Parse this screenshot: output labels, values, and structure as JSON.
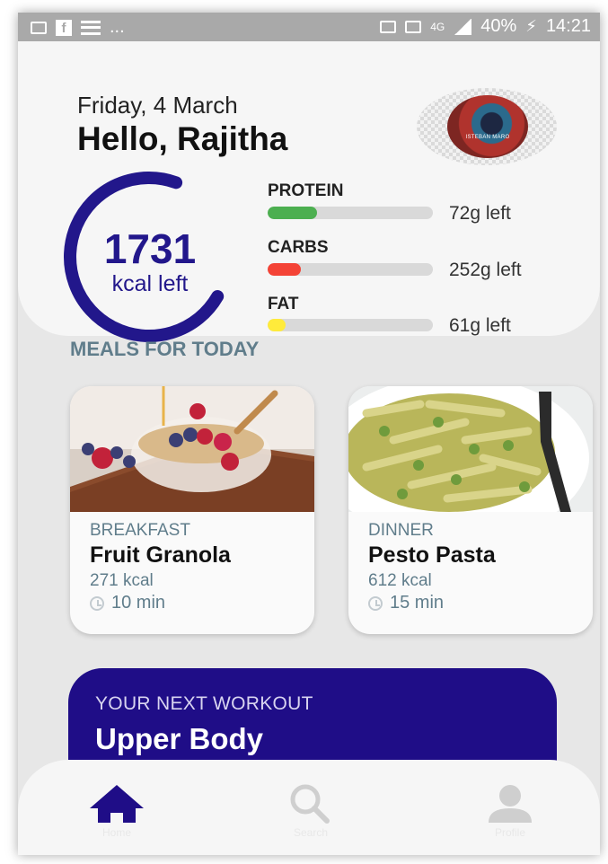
{
  "status_bar": {
    "left_icons": [
      "mail-icon",
      "facebook-icon",
      "menu-icon"
    ],
    "overflow": "...",
    "network": "4G",
    "battery": "40%",
    "time": "14:21"
  },
  "header": {
    "date": "Friday, 4 March",
    "greeting": "Hello, Rajitha",
    "avatar_caption": "ISTEBAN MARO"
  },
  "calories": {
    "value": "1731",
    "label": "kcal left",
    "ring_color": "#22178b"
  },
  "macros": [
    {
      "name": "PROTEIN",
      "left": "72g left",
      "fill_fraction": 0.3,
      "color": "#4caf50"
    },
    {
      "name": "CARBS",
      "left": "252g left",
      "fill_fraction": 0.2,
      "color": "#f44336"
    },
    {
      "name": "FAT",
      "left": "61g left",
      "fill_fraction": 0.11,
      "color": "#ffeb3b"
    }
  ],
  "meals_section": {
    "title": "MEALS FOR TODAY",
    "meals": [
      {
        "type": "BREAKFAST",
        "name": "Fruit Granola",
        "kcal": "271 kcal",
        "time": "10 min"
      },
      {
        "type": "DINNER",
        "name": "Pesto Pasta",
        "kcal": "612 kcal",
        "time": "15 min"
      }
    ]
  },
  "workout": {
    "kicker": "YOUR NEXT WORKOUT",
    "title": "Upper Body",
    "color": "#1f0d87"
  },
  "bottom_nav": {
    "items": [
      {
        "icon": "home-icon",
        "label": "Home",
        "active": true
      },
      {
        "icon": "search-icon",
        "label": "Search",
        "active": false
      },
      {
        "icon": "profile-icon",
        "label": "Profile",
        "active": false
      }
    ]
  }
}
